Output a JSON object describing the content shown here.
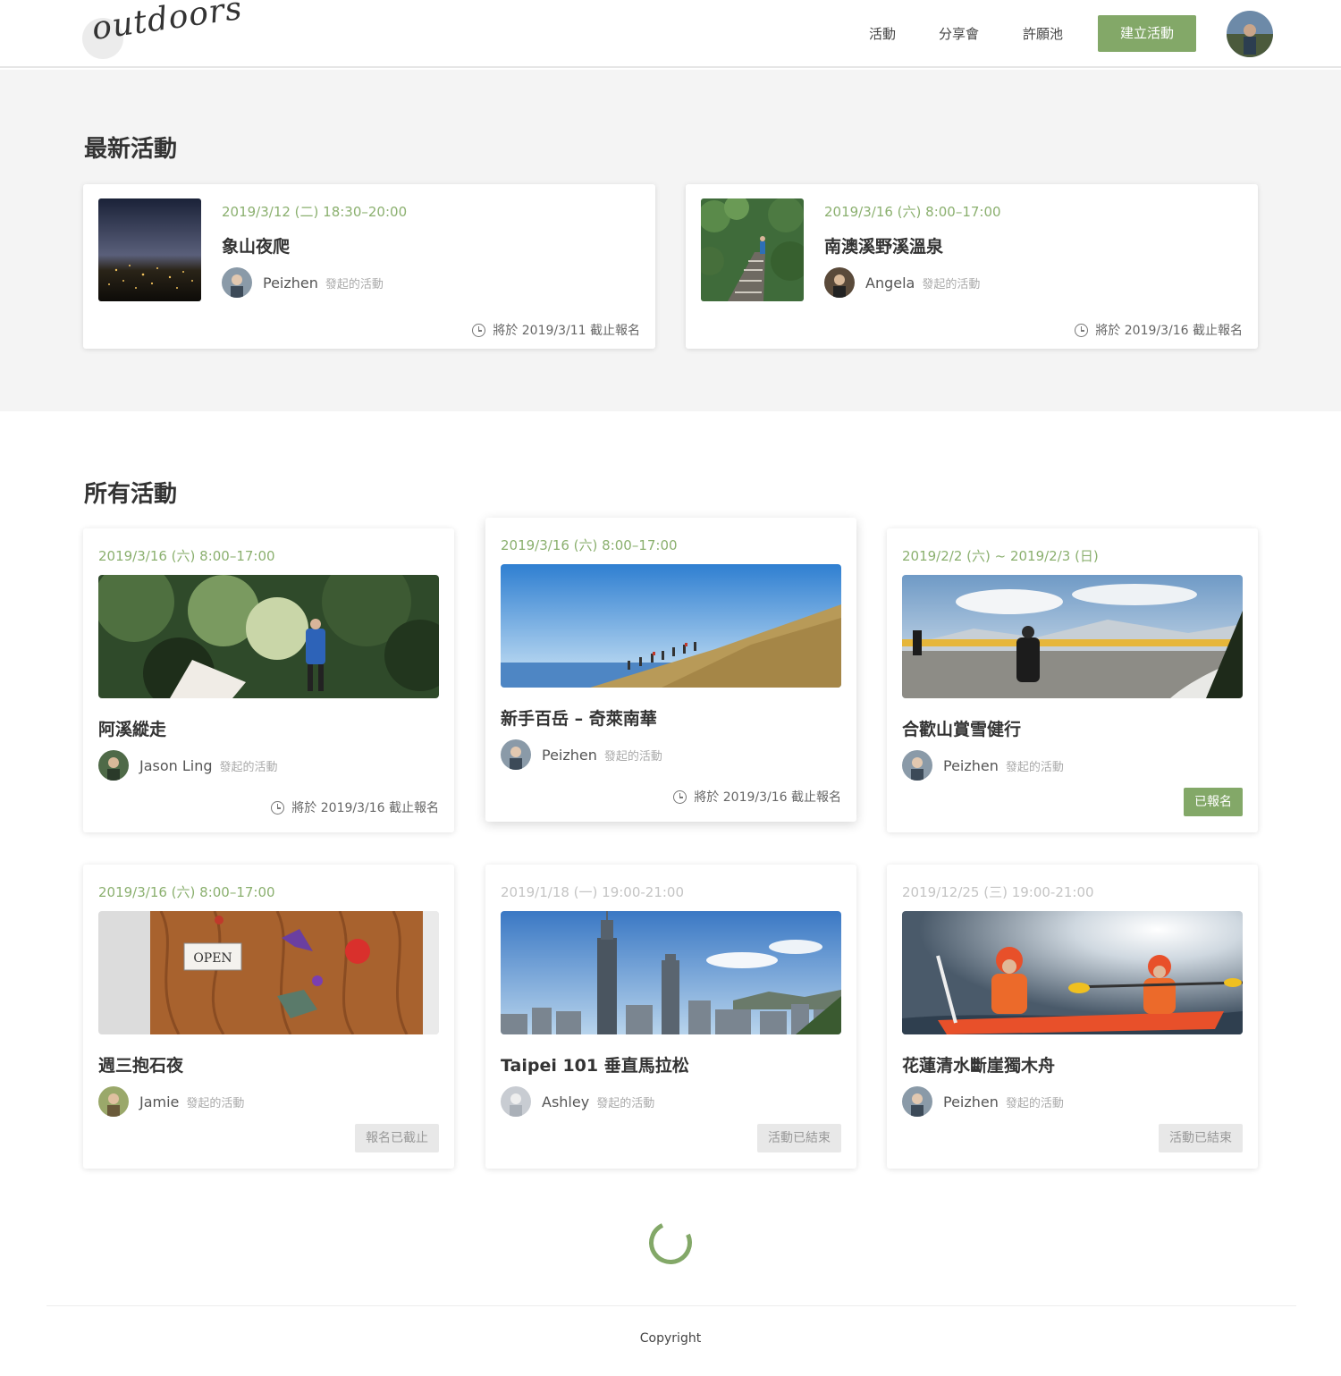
{
  "brand": {
    "logo_text": "outdoors"
  },
  "nav": {
    "links": [
      "活動",
      "分享會",
      "許願池"
    ],
    "create_label": "建立活動"
  },
  "colors": {
    "accent": "#83a868",
    "date_green": "#8bb06f",
    "muted_date": "#c4c4c4",
    "section_bg": "#f4f4f4"
  },
  "latest": {
    "title": "最新活動",
    "cards": [
      {
        "date": "2019/3/12 (二) 18:30–20:00",
        "title": "象山夜爬",
        "host": "Peizhen",
        "host_suffix": "發起的活動",
        "deadline": "將於 2019/3/11 截止報名"
      },
      {
        "date": "2019/3/16 (六) 8:00–17:00",
        "title": "南澳溪野溪溫泉",
        "host": "Angela",
        "host_suffix": "發起的活動",
        "deadline": "將於 2019/3/16 截止報名"
      }
    ]
  },
  "all": {
    "title": "所有活動",
    "cards": [
      {
        "date": "2019/3/16 (六) 8:00–17:00",
        "title": "阿溪縱走",
        "host": "Jason Ling",
        "host_suffix": "發起的活動",
        "deadline": "將於 2019/3/16 截止報名",
        "badge": ""
      },
      {
        "date": "2019/3/16 (六) 8:00–17:00",
        "title": "新手百岳 – 奇萊南華",
        "host": "Peizhen",
        "host_suffix": "發起的活動",
        "deadline": "將於 2019/3/16 截止報名",
        "badge": ""
      },
      {
        "date": "2019/2/2 (六) ~ 2019/2/3 (日)",
        "title": "合歡山賞雪健行",
        "host": "Peizhen",
        "host_suffix": "發起的活動",
        "deadline": "",
        "badge": "已報名"
      },
      {
        "date": "2019/3/16 (六) 8:00–17:00",
        "title": "週三抱石夜",
        "host": "Jamie",
        "host_suffix": "發起的活動",
        "deadline": "",
        "badge": "報名已截止"
      },
      {
        "date": "2019/1/18 (一) 19:00-21:00",
        "title": "Taipei 101 垂直馬拉松",
        "host": "Ashley",
        "host_suffix": "發起的活動",
        "deadline": "",
        "badge": "活動已結束"
      },
      {
        "date": "2019/12/25 (三) 19:00-21:00",
        "title": "花蓮清水斷崖獨木舟",
        "host": "Peizhen",
        "host_suffix": "發起的活動",
        "deadline": "",
        "badge": "活動已結束"
      }
    ]
  },
  "sign_text": "OPEN",
  "footer": {
    "copyright": "Copyright"
  }
}
